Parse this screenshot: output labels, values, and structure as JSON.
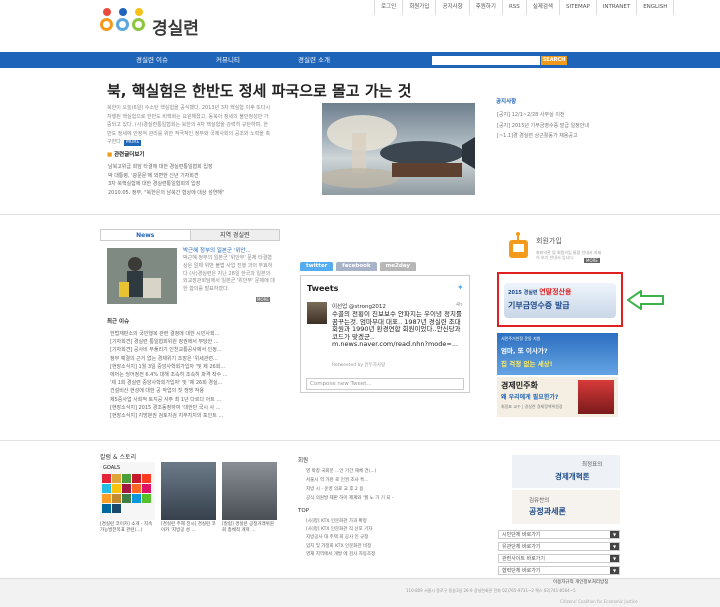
{
  "header": {
    "logo_text": "경실련",
    "top_menu": [
      "로그인",
      "회원가입",
      "공지사항",
      "후원하기",
      "RSS",
      "실제검색",
      "SITEMAP",
      "INTRANET",
      "ENGLISH"
    ],
    "nav": [
      "경실련 이슈",
      "커뮤니티",
      "경실련 소개"
    ],
    "search_placeholder": "",
    "search_label": "SEARCH"
  },
  "hero": {
    "title": "북, 핵실험은 한반도 정세 파국으로 몰고 가는 것",
    "body": "북한이 오늘(6일) 수소탄 핵실험을 공식했다. 2013년 3차 핵실험 이후 또다시 자행된 핵실험으로 한반도 비핵화는 요원해졌고, 동북아 정세의 불안정성만 가중되고 있다. (사)경실련통일협회는 북한의 4차 핵실험을 강력히 규탄하며, 한반도 정세에 안정적 관리를 위한 적극적인 정부와 국제사회의 공조와 노력을 촉구한다.",
    "more": "MORE",
    "related_head": "관련글더보기",
    "related": [
      "남북고위급 회담 타결에 대한 경실련통일협회 입장",
      "박 대통령, '광문문'에 외면한 신년 기자회견",
      "3차 북핵실험에 대한 경실련통일협회의 입장",
      "2010.05. 정부, \"북한은의 남북간 협상에 대상 섬연해\""
    ]
  },
  "notice": {
    "title": "공지사항",
    "items": [
      "[공지] 12/1~2/28 사무실 이전",
      "[공지] 2015년 기부금영수증 발급 일정안내",
      "[~1.1]경 경실련 상근활동가 채용공고"
    ]
  },
  "news": {
    "tabs": [
      "News",
      "지역 경실련"
    ],
    "headline": "박근혜 정부의 일본군 '위안...",
    "text": "박근혜 정부의 일본군 '위안부' 문제 타결협상은 일제 위반 불법 사업 진행 과의 무효하다 (사)경실련은 지난 28일 한국과 일본의 외교장관회담에서 일본군 '위안부' 문제에 대한 합의를 발표하였다.",
    "more": "MORE",
    "recent_head": "최근 이슈",
    "recent": [
      "헌법재판소의 국민행복 관련 결정에 대한 시민사회...",
      "[기자회견] 경실련 통일협회위원 정권에서 부당한 ...",
      "[기자회견] 공사비 부풀리기 인천교통공사에서 인정...",
      "정부 예결의 근거 없는 경제위기 조장은 '위세관련...",
      "[현장소식지] 1월 3일 중앙사학회가입자 '및 제 26회...",
      "에어는 엉어정전 6.4% 대해 조속히 조속히 파격 착수 ...",
      "'제 1회 경실련 중앙사학회가입자' 및 '제 26회 경실...",
      "건설비산 현성에 대한 공 작업의 짓 쟁쟁 작용",
      "제5중사업 사회적 토지공 사주 최 1년 다르다 아트 ...",
      "[현장소식지] 2015 경조동정하여 '대한민 국시 사 ...",
      "[현장소식지] 지방분권 검토지검 지부지지의 포인트 ..."
    ]
  },
  "twitter": {
    "tabs": [
      "twitter",
      "facebook",
      "me2day"
    ],
    "title": "Tweets",
    "name": "이선업 @strong2012",
    "time": "4h",
    "text": "수꼴의 전횡이 진보보수 안파지는 우이녕 정치를 꿈꾸는것. 엄마부대 대표.. 1987년 경실련 조대회원과 1990년 환경연합 회원이었다..안신당과 코드가 맞겠군.. m.news.naver.com/read.nhn?mode=...",
    "retweet": "Retweeted by 안두자사랑",
    "compose": "Compose new Tweet..."
  },
  "side": {
    "join_title": "회원가입",
    "join_desc": "회비약관 및 회원가입 통합 안내서 자세히 보기 안내서 입니다.",
    "join_btn": "MORE",
    "donate_l1_a": "2015 경실련 ",
    "donate_l1_b": "연말정산용",
    "donate_l2": "기부금영수증 발급",
    "banner2_small": "서민주거안정 운동 지원",
    "banner2_t1": "엄마, 또 이사가?",
    "banner2_t2": "집 걱정 없는 세상!",
    "banner3_t1": "경제민주화",
    "banner3_t2": "왜 우리에게 필요한가?",
    "banner3_t3": "최정표 교수 | 경실련 경제정책위원장"
  },
  "bottom": {
    "cal_head": "칼럼 & 스토리",
    "goals_title": "GOALS",
    "captions": [
      "[경실련 코이카] 소개 - 지속가능발전목표 관련(...)",
      "[경실련 주제 전시] 경실련 코이카 '지방공 성 ...",
      "[칼럼] 경실련 공정거래위원회 총체적 개혁 ..."
    ],
    "members_head": "회원",
    "members": [
      "영 박창 국회분 ...안 기간 해체 건(...)",
      "서울시 역 가천 로 인권 조사 특...",
      "지방 시 - 운영 의료 교 후 2 용",
      "공식 의원발 재판 하이 제계와 '월 노 가 기 되 -"
    ],
    "top_head": "TOP",
    "top": [
      "[사]정] KTX 인문화관 가과 확정",
      "[사]정] KTX 인문화관 직 선포 기자",
      "지방공사 대 주택 회 공사 인 규정",
      "입지 및 가정회 KTX 인문화관 비정",
      "영재 지역에서 개발 에 검사 자동조정"
    ],
    "col1_t1": "최정표의",
    "col1_t2": "경제개혁론",
    "col2_t1": "김유찬의",
    "col2_t2": "공정과세론",
    "selects": [
      "시민단체 바로가기",
      "유관단체 바로가기",
      "관련사이트 바로가기",
      "협력단체 바로가기"
    ]
  },
  "footer": {
    "links": "이용자규칙   개인정보처리방침",
    "address": "110-809 서울시 종로구 동숭3길 26-9 경실련회관 전화 02)765-9731~2 팩스 02)741-8564~5",
    "english": "Citizens' Coalition for Economic Justice"
  },
  "colors": {
    "nav_blue": "#1e64b8",
    "accent_orange": "#f39a1b",
    "highlight_red": "#e02020",
    "arrow_green": "#3bb34a"
  }
}
